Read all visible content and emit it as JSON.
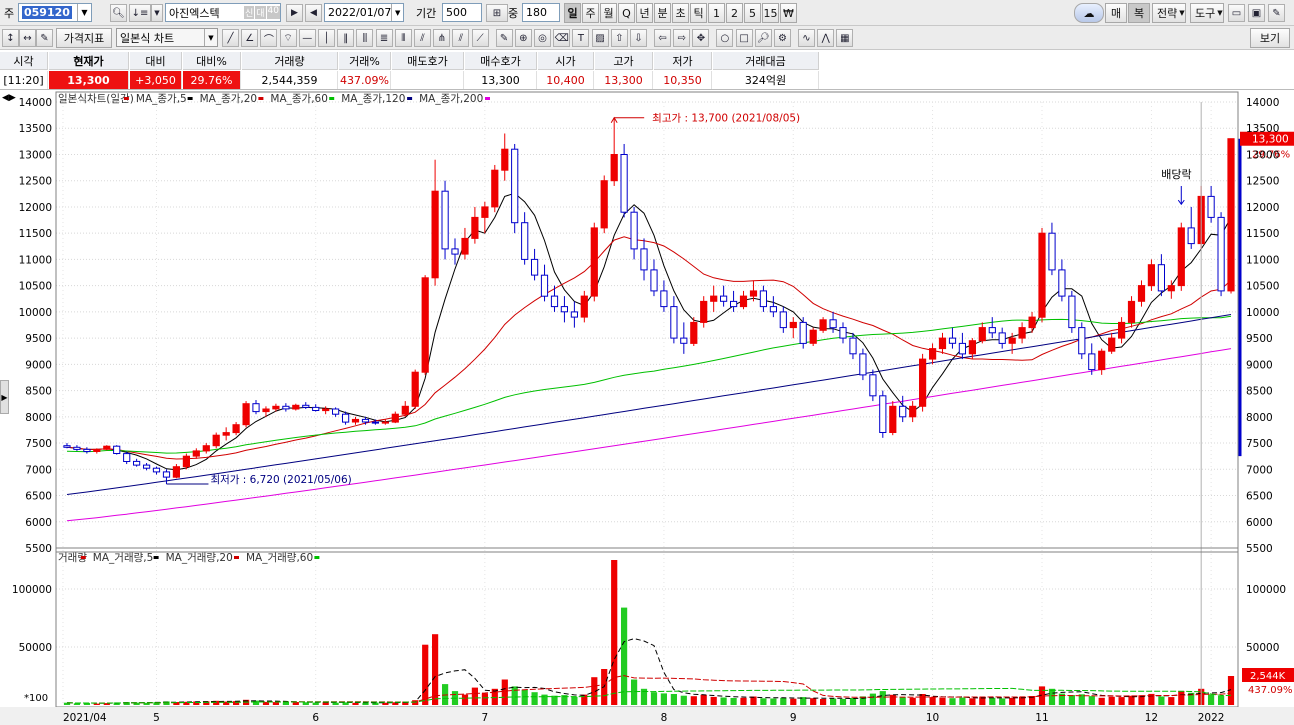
{
  "toolbar1": {
    "market_label": "주",
    "code_value": "059120",
    "stock_name": "아진엑스텍",
    "badges": [
      "신",
      "대",
      "40"
    ],
    "date_value": "2022/01/07",
    "period_label": "기간",
    "period_value": "500",
    "count_label": "중",
    "count_value": "180",
    "periods": [
      "일",
      "주",
      "월",
      "Q",
      "년",
      "분",
      "초",
      "틱",
      "1",
      "2",
      "5",
      "15",
      "₩"
    ],
    "right_buttons": [
      "매",
      "복",
      "전략",
      "도구"
    ]
  },
  "toolbar2": {
    "price_indicator": "가격지표",
    "chart_type": "일본식 차트",
    "view_button": "보기"
  },
  "quote": {
    "headers": [
      "시각",
      "현재가",
      "대비",
      "대비%",
      "거래량",
      "거래%",
      "매도호가",
      "매수호가",
      "시가",
      "고가",
      "저가",
      "거래대금"
    ],
    "values": [
      "[11:20]",
      "13,300",
      "+3,050",
      "29.76%",
      "2,544,359",
      "437.09%",
      "",
      "13,300",
      "10,400",
      "13,300",
      "10,350",
      "324억원"
    ]
  },
  "chart_data": [
    {
      "type": "candlestick",
      "legend": [
        {
          "name": "일본식차트(일간)",
          "color": "#d00000"
        },
        {
          "name": "MA_종가,5",
          "color": "#000000"
        },
        {
          "name": "MA_종가,20",
          "color": "#d00000"
        },
        {
          "name": "MA_종가,60",
          "color": "#00c000"
        },
        {
          "name": "MA_종가,120",
          "color": "#000080"
        },
        {
          "name": "MA_종가,200",
          "color": "#e000e0"
        }
      ],
      "ylim": [
        5500,
        14000
      ],
      "yticks": [
        5500,
        6000,
        6500,
        7000,
        7500,
        8000,
        8500,
        9000,
        9500,
        10000,
        10500,
        11000,
        11500,
        12000,
        12500,
        13000,
        13500,
        14000
      ],
      "xticks": [
        "2021/04",
        "5",
        "6",
        "7",
        "8",
        "9",
        "10",
        "11",
        "12",
        "2022"
      ],
      "annotations": {
        "high": "최고가 : 13,700 (2021/08/05)",
        "low": "최저가 : 6,720 (2021/05/06)",
        "dividend": "배당락"
      },
      "last_price_label": "13,300",
      "last_change_label": "29.76%",
      "ohlc": [
        [
          7450,
          7500,
          7400,
          7420
        ],
        [
          7420,
          7460,
          7350,
          7380
        ],
        [
          7380,
          7420,
          7300,
          7340
        ],
        [
          7340,
          7400,
          7300,
          7380
        ],
        [
          7380,
          7460,
          7360,
          7440
        ],
        [
          7440,
          7460,
          7280,
          7300
        ],
        [
          7300,
          7340,
          7100,
          7150
        ],
        [
          7150,
          7200,
          7050,
          7080
        ],
        [
          7080,
          7120,
          6980,
          7020
        ],
        [
          7020,
          7050,
          6900,
          6950
        ],
        [
          6950,
          7000,
          6720,
          6850
        ],
        [
          6850,
          7100,
          6830,
          7050
        ],
        [
          7050,
          7300,
          7000,
          7250
        ],
        [
          7250,
          7400,
          7200,
          7350
        ],
        [
          7350,
          7500,
          7300,
          7450
        ],
        [
          7450,
          7700,
          7400,
          7650
        ],
        [
          7650,
          7800,
          7550,
          7700
        ],
        [
          7700,
          7900,
          7650,
          7850
        ],
        [
          7850,
          8300,
          7800,
          8250
        ],
        [
          8250,
          8320,
          8050,
          8100
        ],
        [
          8100,
          8200,
          8000,
          8150
        ],
        [
          8150,
          8250,
          8100,
          8200
        ],
        [
          8200,
          8260,
          8100,
          8150
        ],
        [
          8150,
          8250,
          8120,
          8220
        ],
        [
          8220,
          8280,
          8150,
          8180
        ],
        [
          8180,
          8240,
          8100,
          8120
        ],
        [
          8120,
          8200,
          8050,
          8150
        ],
        [
          8150,
          8180,
          8000,
          8050
        ],
        [
          8050,
          8100,
          7850,
          7900
        ],
        [
          7900,
          8000,
          7850,
          7950
        ],
        [
          7950,
          8000,
          7850,
          7900
        ],
        [
          7900,
          7950,
          7850,
          7880
        ],
        [
          7880,
          7950,
          7850,
          7900
        ],
        [
          7900,
          8100,
          7880,
          8050
        ],
        [
          8050,
          8300,
          8000,
          8200
        ],
        [
          8200,
          8900,
          8150,
          8850
        ],
        [
          8850,
          10700,
          8800,
          10650
        ],
        [
          10650,
          12900,
          10500,
          12300
        ],
        [
          12300,
          12500,
          11000,
          11200
        ],
        [
          11200,
          11400,
          10900,
          11100
        ],
        [
          11100,
          11600,
          11000,
          11400
        ],
        [
          11400,
          12000,
          11300,
          11800
        ],
        [
          11800,
          12100,
          11500,
          12000
        ],
        [
          12000,
          12800,
          11900,
          12700
        ],
        [
          12700,
          13400,
          12500,
          13100
        ],
        [
          13100,
          13200,
          11500,
          11700
        ],
        [
          11700,
          11900,
          10900,
          11000
        ],
        [
          11000,
          11200,
          10600,
          10700
        ],
        [
          10700,
          10900,
          10200,
          10300
        ],
        [
          10300,
          10500,
          10000,
          10100
        ],
        [
          10100,
          10300,
          9800,
          10000
        ],
        [
          10000,
          10200,
          9700,
          9900
        ],
        [
          9900,
          10400,
          9800,
          10300
        ],
        [
          10300,
          11700,
          10200,
          11600
        ],
        [
          11600,
          12600,
          11500,
          12500
        ],
        [
          12500,
          13700,
          12400,
          13000
        ],
        [
          13000,
          13200,
          11800,
          11900
        ],
        [
          11900,
          12000,
          11000,
          11200
        ],
        [
          11200,
          11400,
          10600,
          10800
        ],
        [
          10800,
          11000,
          10300,
          10400
        ],
        [
          10400,
          10600,
          10000,
          10100
        ],
        [
          10100,
          10300,
          9400,
          9500
        ],
        [
          9500,
          9800,
          9200,
          9400
        ],
        [
          9400,
          9900,
          9350,
          9800
        ],
        [
          9800,
          10300,
          9700,
          10200
        ],
        [
          10200,
          10500,
          10000,
          10300
        ],
        [
          10300,
          10500,
          10100,
          10200
        ],
        [
          10200,
          10400,
          10000,
          10100
        ],
        [
          10100,
          10400,
          10050,
          10300
        ],
        [
          10300,
          10600,
          10200,
          10400
        ],
        [
          10400,
          10500,
          10000,
          10100
        ],
        [
          10100,
          10300,
          9900,
          10000
        ],
        [
          10000,
          10100,
          9600,
          9700
        ],
        [
          9700,
          9900,
          9500,
          9800
        ],
        [
          9800,
          9900,
          9300,
          9400
        ],
        [
          9400,
          9700,
          9350,
          9650
        ],
        [
          9650,
          9900,
          9600,
          9850
        ],
        [
          9850,
          10000,
          9600,
          9700
        ],
        [
          9700,
          9800,
          9400,
          9500
        ],
        [
          9500,
          9600,
          9100,
          9200
        ],
        [
          9200,
          9300,
          8700,
          8800
        ],
        [
          8800,
          8900,
          8300,
          8400
        ],
        [
          8400,
          8500,
          7600,
          7700
        ],
        [
          7700,
          8300,
          7650,
          8200
        ],
        [
          8200,
          8400,
          7900,
          8000
        ],
        [
          8000,
          8300,
          7900,
          8200
        ],
        [
          8200,
          9200,
          8100,
          9100
        ],
        [
          9100,
          9400,
          9000,
          9300
        ],
        [
          9300,
          9600,
          9200,
          9500
        ],
        [
          9500,
          9700,
          9300,
          9400
        ],
        [
          9400,
          9600,
          9100,
          9200
        ],
        [
          9200,
          9500,
          9100,
          9450
        ],
        [
          9450,
          9800,
          9400,
          9700
        ],
        [
          9700,
          9900,
          9500,
          9600
        ],
        [
          9600,
          9700,
          9300,
          9400
        ],
        [
          9400,
          9600,
          9200,
          9500
        ],
        [
          9500,
          9800,
          9400,
          9700
        ],
        [
          9700,
          10000,
          9600,
          9900
        ],
        [
          9900,
          11600,
          9800,
          11500
        ],
        [
          11500,
          11700,
          10700,
          10800
        ],
        [
          10800,
          11000,
          10200,
          10300
        ],
        [
          10300,
          10400,
          9600,
          9700
        ],
        [
          9700,
          9800,
          9100,
          9200
        ],
        [
          9200,
          9400,
          8800,
          8900
        ],
        [
          8900,
          9300,
          8800,
          9250
        ],
        [
          9250,
          9600,
          9200,
          9500
        ],
        [
          9500,
          9900,
          9400,
          9800
        ],
        [
          9800,
          10300,
          9700,
          10200
        ],
        [
          10200,
          10600,
          10100,
          10500
        ],
        [
          10500,
          11000,
          10400,
          10900
        ],
        [
          10900,
          11100,
          10300,
          10400
        ],
        [
          10400,
          10600,
          10250,
          10500
        ],
        [
          10500,
          11700,
          10400,
          11600
        ],
        [
          11600,
          12000,
          11200,
          11300
        ],
        [
          11300,
          12400,
          11200,
          12200
        ],
        [
          12200,
          12400,
          11700,
          11800
        ],
        [
          11800,
          11900,
          10300,
          10400
        ],
        [
          10400,
          13300,
          10350,
          13300
        ]
      ]
    },
    {
      "type": "bar",
      "legend": [
        {
          "name": "거래량",
          "color": "#d00000"
        },
        {
          "name": "MA_거래량,5",
          "color": "#000000"
        },
        {
          "name": "MA_거래량,20",
          "color": "#d00000"
        },
        {
          "name": "MA_거래량,60",
          "color": "#00c000"
        }
      ],
      "ylim": [
        0,
        125000
      ],
      "yticks": [
        50000,
        100000
      ],
      "ytick_labels": [
        "50000",
        "100000"
      ],
      "unit_label": "*100",
      "last_volume_label": "2,544K",
      "last_volume_pct": "437.09%",
      "volumes": [
        2000,
        1500,
        1800,
        1200,
        1600,
        2200,
        2500,
        2100,
        1900,
        2400,
        3100,
        2600,
        2800,
        3000,
        3200,
        3600,
        2900,
        3300,
        4500,
        3800,
        2700,
        2500,
        2200,
        2600,
        2300,
        2100,
        2400,
        2000,
        2200,
        1900,
        1800,
        2100,
        2000,
        2300,
        2900,
        4100,
        52000,
        61000,
        18000,
        12000,
        9000,
        15000,
        10000,
        14000,
        22000,
        16000,
        13000,
        11000,
        9000,
        8000,
        8500,
        7000,
        9000,
        24000,
        31000,
        125000,
        84000,
        22000,
        14000,
        11000,
        10000,
        9500,
        8000,
        7600,
        8800,
        7000,
        6500,
        6000,
        6200,
        7300,
        5800,
        5600,
        6200,
        5400,
        6800,
        5900,
        5200,
        5600,
        5300,
        6000,
        7400,
        9800,
        12000,
        8800,
        6700,
        6200,
        9500,
        6800,
        6100,
        5900,
        6400,
        5800,
        6600,
        6200,
        5700,
        6100,
        6900,
        7800,
        16000,
        14000,
        9800,
        8500,
        9200,
        7700,
        6200,
        7100,
        6800,
        7900,
        8400,
        9600,
        7300,
        6800,
        12000,
        10500,
        14000,
        9000,
        7800,
        25000
      ]
    }
  ]
}
